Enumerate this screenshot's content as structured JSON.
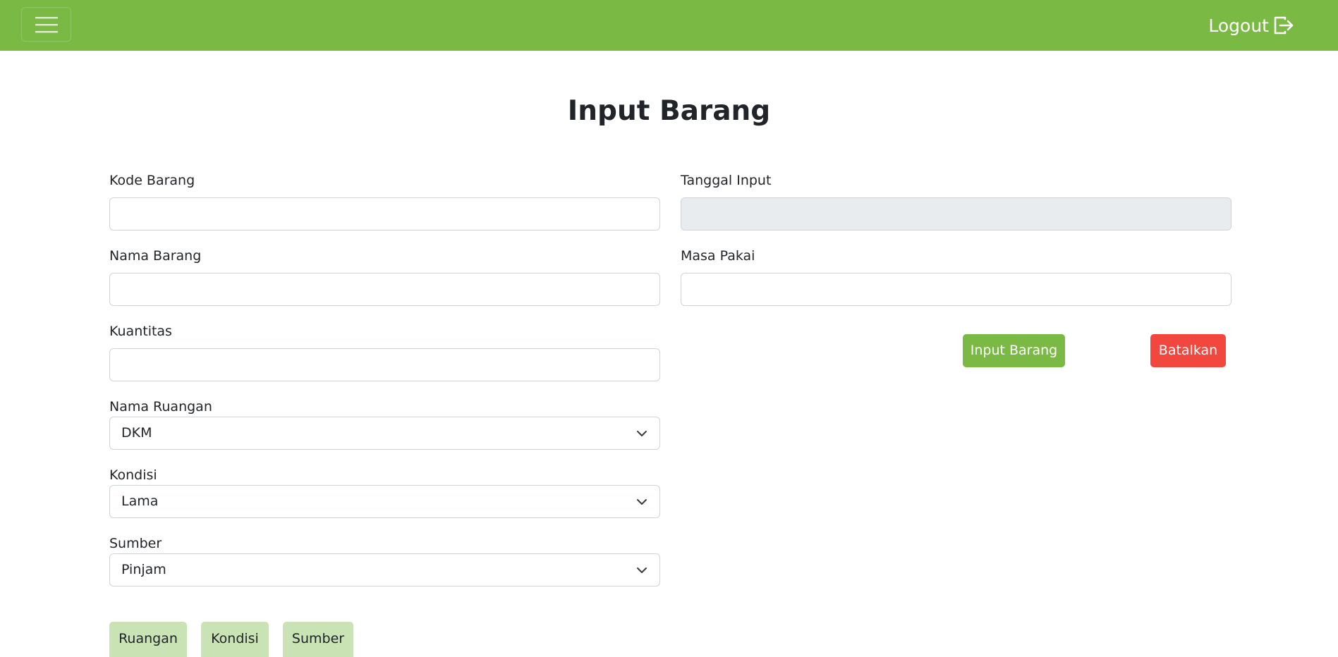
{
  "navbar": {
    "menu_icon": "hamburger-menu-icon",
    "logout_label": "Logout",
    "logout_icon": "logout-icon",
    "color": "#7aba44"
  },
  "page": {
    "title": "Input Barang"
  },
  "form": {
    "kode_barang": {
      "label": "Kode Barang",
      "value": ""
    },
    "tanggal_input": {
      "label": "Tanggal Input",
      "value": ""
    },
    "nama_barang": {
      "label": "Nama Barang",
      "value": ""
    },
    "masa_pakai": {
      "label": "Masa Pakai",
      "value": ""
    },
    "kuantitas": {
      "label": "Kuantitas",
      "value": ""
    },
    "nama_ruangan": {
      "label": "Nama Ruangan",
      "selected": "DKM"
    },
    "kondisi": {
      "label": "Kondisi",
      "selected": "Lama"
    },
    "sumber": {
      "label": "Sumber",
      "selected": "Pinjam"
    }
  },
  "actions": {
    "submit_label": "Input Barang",
    "cancel_label": "Batalkan",
    "submit_color": "#7aba44",
    "cancel_color": "#f1473f"
  },
  "shortcuts": {
    "ruangan": "Ruangan",
    "kondisi": "Kondisi",
    "sumber": "Sumber",
    "color": "#c9e3b4"
  }
}
